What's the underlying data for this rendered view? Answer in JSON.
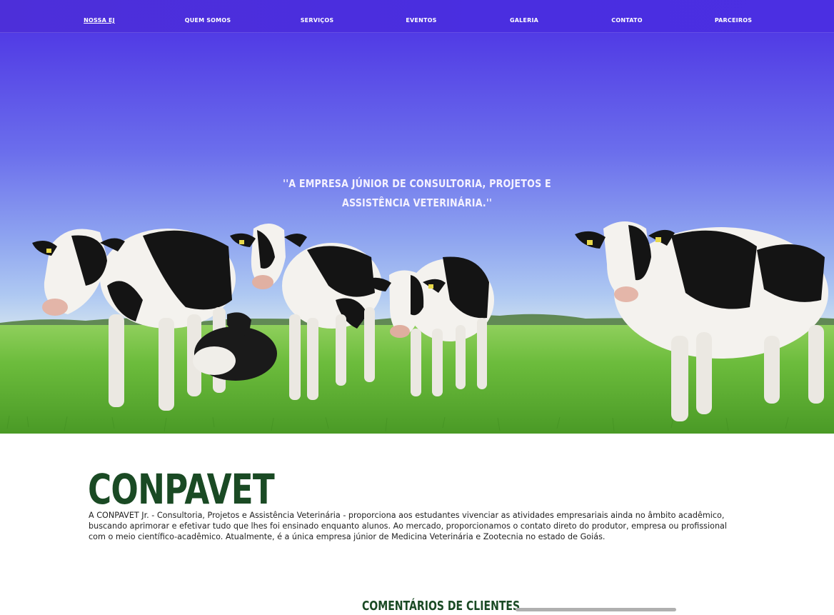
{
  "nav": {
    "items": [
      {
        "label": "NOSSA EJ",
        "active": true
      },
      {
        "label": "QUEM SOMOS",
        "active": false
      },
      {
        "label": "SERVIÇOS",
        "active": false
      },
      {
        "label": "EVENTOS",
        "active": false
      },
      {
        "label": "GALERIA",
        "active": false
      },
      {
        "label": "CONTATO",
        "active": false
      },
      {
        "label": "PARCEIROS",
        "active": false
      }
    ]
  },
  "hero": {
    "quote_line1": "''A EMPRESA JÚNIOR DE CONSULTORIA, PROJETOS E",
    "quote_line2": "ASSISTÊNCIA VETERINÁRIA.''",
    "image": "holstein-cows-in-pasture-photo"
  },
  "about": {
    "title": "CONPAVET",
    "text": "A CONPAVET Jr. - Consultoria, Projetos e Assistência Veterinária - proporciona aos estudantes vivenciar as atividades empresariais ainda no âmbito acadêmico, buscando aprimorar e efetivar tudo que lhes foi ensinado enquanto alunos. Ao mercado, proporcionamos o contato direto do produtor, empresa ou profissional com o meio científico-acadêmico. Atualmente, é a única empresa júnior de Medicina Veterinária e Zootecnia no estado de Goiás."
  },
  "reviews": {
    "title": "COMENTÁRIOS DE CLIENTES"
  },
  "colors": {
    "nav_bg": "#4b2fe0",
    "brand_green": "#1a4a24",
    "grass": "#5cb030",
    "text": "#222222"
  }
}
